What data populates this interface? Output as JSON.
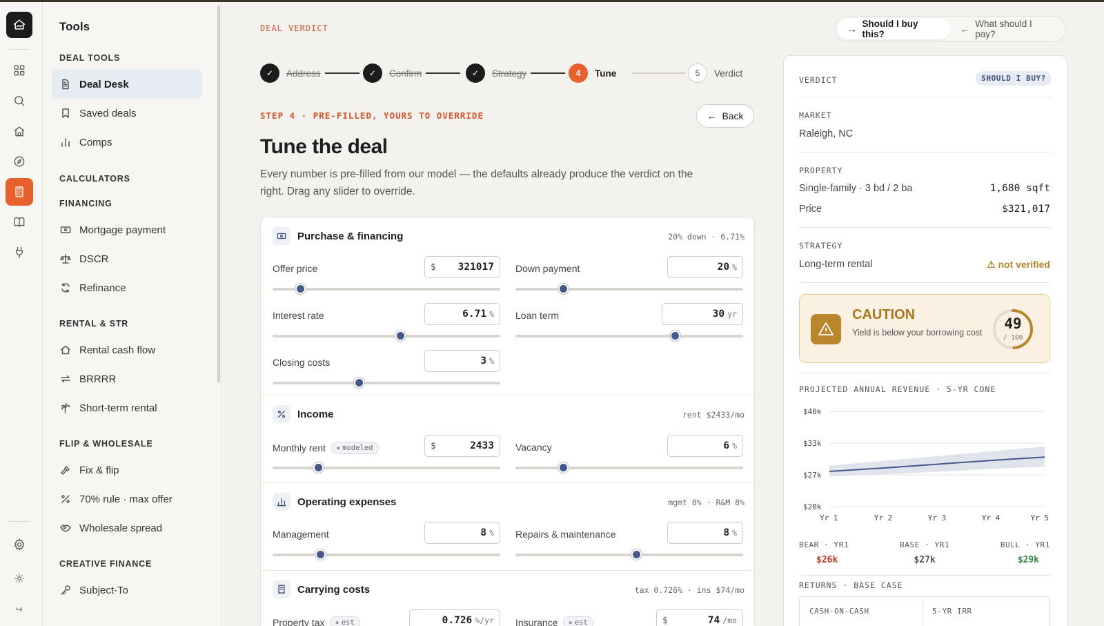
{
  "rail": {
    "icons": [
      "home-logo-icon",
      "grid-icon",
      "search-icon",
      "house-icon",
      "compass-icon",
      "calculator-icon",
      "book-icon",
      "plug-icon",
      "gear-icon",
      "sun-icon",
      "logout-icon"
    ]
  },
  "tools": {
    "title": "Tools",
    "deal_tools_label": "DEAL TOOLS",
    "deal_tools": [
      "Deal Desk",
      "Saved deals",
      "Comps"
    ],
    "calculators_label": "CALCULATORS",
    "financing_label": "FINANCING",
    "financing": [
      "Mortgage payment",
      "DSCR",
      "Refinance"
    ],
    "rental_label": "RENTAL & STR",
    "rental": [
      "Rental cash flow",
      "BRRRR",
      "Short-term rental"
    ],
    "flip_label": "FLIP & WHOLESALE",
    "flip": [
      "Fix & flip",
      "70% rule · max offer",
      "Wholesale spread"
    ],
    "creative_label": "CREATIVE FINANCE",
    "creative": [
      "Subject-To"
    ]
  },
  "header": {
    "eyebrow": "DEAL VERDICT",
    "toggle_buy": "Should I buy this?",
    "toggle_pay": "What should I pay?"
  },
  "steps": [
    {
      "num": "1",
      "label": "Address",
      "state": "done"
    },
    {
      "num": "2",
      "label": "Confirm",
      "state": "done"
    },
    {
      "num": "3",
      "label": "Strategy",
      "state": "done"
    },
    {
      "num": "4",
      "label": "Tune",
      "state": "current"
    },
    {
      "num": "5",
      "label": "Verdict",
      "state": "todo"
    }
  ],
  "tune": {
    "subhead": "STEP 4 · PRE-FILLED, YOURS TO OVERRIDE",
    "back_label": "Back",
    "title": "Tune the deal",
    "description": "Every number is pre-filled from our model — the defaults already produce the verdict on the right. Drag any slider to override."
  },
  "groups": {
    "purchase": {
      "title": "Purchase & financing",
      "summary": "20% down · 6.71%",
      "offer_price": {
        "label": "Offer price",
        "prefix": "$",
        "value": "321017",
        "slider": 0.12
      },
      "down_payment": {
        "label": "Down payment",
        "value": "20",
        "suffix": "%",
        "slider": 0.21
      },
      "interest_rate": {
        "label": "Interest rate",
        "value": "6.71",
        "suffix": "%",
        "slider": 0.56
      },
      "loan_term": {
        "label": "Loan term",
        "value": "30",
        "suffix": "yr",
        "slider": 0.7
      },
      "closing_costs": {
        "label": "Closing costs",
        "value": "3",
        "suffix": "%",
        "slider": 0.38
      }
    },
    "income": {
      "title": "Income",
      "summary": "rent $2433/mo",
      "monthly_rent": {
        "label": "Monthly rent",
        "tag": "modeled",
        "prefix": "$",
        "value": "2433",
        "slider": 0.2
      },
      "vacancy": {
        "label": "Vacancy",
        "value": "6",
        "suffix": "%",
        "slider": 0.21
      }
    },
    "opex": {
      "title": "Operating expenses",
      "summary": "mgmt 8% · R&M 8%",
      "management": {
        "label": "Management",
        "value": "8",
        "suffix": "%",
        "slider": 0.21
      },
      "repairs": {
        "label": "Repairs & maintenance",
        "value": "8",
        "suffix": "%",
        "slider": 0.53
      }
    },
    "carrying": {
      "title": "Carrying costs",
      "summary": "tax 0.726% · ins $74/mo",
      "property_tax": {
        "label": "Property tax",
        "tag": "est",
        "value": "0.726",
        "suffix": "%/yr"
      },
      "insurance": {
        "label": "Insurance",
        "tag": "est",
        "prefix": "$",
        "value": "74",
        "suffix": "/mo"
      }
    }
  },
  "verdict": {
    "label": "VERDICT",
    "badge": "SHOULD I BUY?",
    "market_label": "MARKET",
    "market": "Raleigh, NC",
    "property_label": "PROPERTY",
    "property_type": "Single-family · 3 bd / 2 ba",
    "sqft": "1,680 sqft",
    "price_label": "Price",
    "price": "$321,017",
    "strategy_label": "STRATEGY",
    "strategy": "Long-term rental",
    "strategy_status": "not verified",
    "caution_title": "CAUTION",
    "caution_text": "Yield is below your borrowing cost",
    "score": "49",
    "score_max": "/ 100",
    "score_fraction": 0.49,
    "revenue_label": "PROJECTED ANNUAL REVENUE · 5-YR CONE",
    "cases": [
      {
        "label": "BEAR · YR1",
        "value": "$26k",
        "color": "#c0392b"
      },
      {
        "label": "BASE · YR1",
        "value": "$27k",
        "color": "#1c1c1c"
      },
      {
        "label": "BULL · YR1",
        "value": "$29k",
        "color": "#2e8b3e"
      }
    ],
    "returns_label": "RETURNS · BASE CASE",
    "returns_cells": [
      "CASH-ON-CASH",
      "5-YR IRR"
    ]
  },
  "chart_data": {
    "type": "area",
    "categories": [
      "Yr 1",
      "Yr 2",
      "Yr 3",
      "Yr 4",
      "Yr 5"
    ],
    "y_ticks": [
      "$40k",
      "$33k",
      "$27k",
      "$20k"
    ],
    "ylim": [
      20,
      40
    ],
    "series": [
      {
        "values": [
          27.4,
          28.1,
          28.9,
          29.7,
          30.4
        ]
      }
    ],
    "band_low": [
      26.3,
      26.8,
      27.3,
      27.9,
      28.4
    ],
    "band_high": [
      28.6,
      29.6,
      30.6,
      31.6,
      32.6
    ],
    "grid": true,
    "line_color": "#45578b",
    "band_color": "#dfe3ec"
  }
}
